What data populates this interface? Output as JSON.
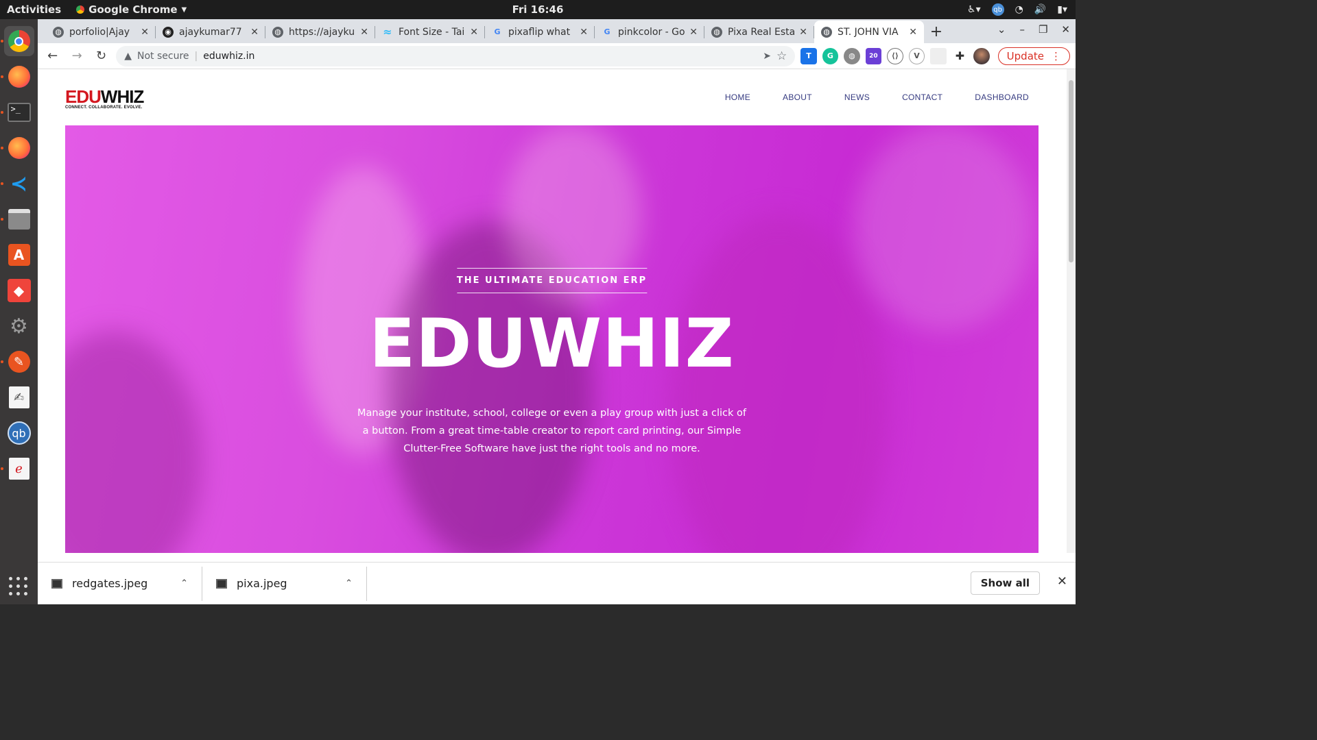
{
  "system": {
    "activities": "Activities",
    "app_name": "Google Chrome",
    "clock": "Fri 16:46"
  },
  "tabs": [
    {
      "title": "porfolio|Ajay",
      "icon": "globe-icon"
    },
    {
      "title": "ajaykumar77",
      "icon": "github-icon"
    },
    {
      "title": "https://ajayku",
      "icon": "globe-icon"
    },
    {
      "title": "Font Size - Tai",
      "icon": "tailwind-icon"
    },
    {
      "title": "pixaflip what",
      "icon": "google-icon"
    },
    {
      "title": "pinkcolor - Go",
      "icon": "google-icon"
    },
    {
      "title": "Pixa Real Esta",
      "icon": "globe-icon"
    },
    {
      "title": "ST. JOHN VIA",
      "icon": "globe-icon"
    }
  ],
  "omnibox": {
    "security": "Not secure",
    "url": "eduwhiz.in"
  },
  "extensions": [
    {
      "name": "translate-icon",
      "label": "T",
      "color": "#1a73e8"
    },
    {
      "name": "grammarly-icon",
      "label": "G",
      "color": "#15c39a"
    },
    {
      "name": "globe-ext-icon",
      "label": "◍",
      "color": "#888888"
    },
    {
      "name": "counter-ext-icon",
      "label": "20",
      "color": "#6b3fd6"
    },
    {
      "name": "code-ext-icon",
      "label": "⟨⟩",
      "color": "#666666"
    },
    {
      "name": "vue-ext-icon",
      "label": "V",
      "color": "#555555"
    },
    {
      "name": "blank-ext-icon",
      "label": "",
      "color": "#dddddd"
    }
  ],
  "update_label": "Update",
  "site": {
    "logo_edu": "EDU",
    "logo_whiz": "WHIZ",
    "logo_tagline": "CONNECT. COLLABORATE. EVOLVE.",
    "nav": [
      "HOME",
      "ABOUT",
      "NEWS",
      "CONTACT",
      "DASHBOARD"
    ],
    "hero_kicker": "THE ULTIMATE EDUCATION ERP",
    "hero_title": "EDUWHIZ",
    "hero_desc": "Manage your institute, school, college or even a play group with just a click of a button. From a great time-table creator to report card printing, our Simple Clutter-Free Software have just the right tools and no more.",
    "accent": "#d13cd9"
  },
  "downloads": {
    "items": [
      "redgates.jpeg",
      "pixa.jpeg"
    ],
    "show_all": "Show all"
  }
}
